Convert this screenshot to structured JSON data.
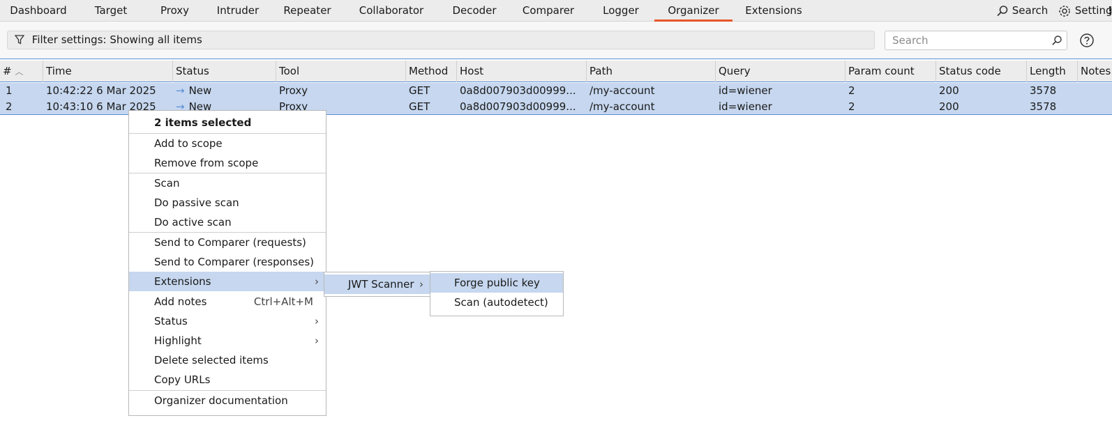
{
  "tabs": [
    {
      "label": "Dashboard"
    },
    {
      "label": "Target"
    },
    {
      "label": "Proxy"
    },
    {
      "label": "Intruder"
    },
    {
      "label": "Repeater"
    },
    {
      "label": "Collaborator"
    },
    {
      "label": "Decoder"
    },
    {
      "label": "Comparer"
    },
    {
      "label": "Logger"
    },
    {
      "label": "Organizer"
    },
    {
      "label": "Extensions"
    }
  ],
  "active_tab": "Organizer",
  "accent_color": "#e8552a",
  "selection_color": "#c6d7ef",
  "top_right": {
    "search_label": "Search",
    "settings_label": "Setting"
  },
  "filter": {
    "text": "Filter settings: Showing all items"
  },
  "search": {
    "placeholder": "Search"
  },
  "table": {
    "columns": [
      "#",
      "Time",
      "Status",
      "Tool",
      "Method",
      "Host",
      "Path",
      "Query",
      "Param count",
      "Status code",
      "Length",
      "Notes"
    ],
    "rows": [
      {
        "num": "1",
        "time": "10:42:22 6 Mar 2025",
        "status": "New",
        "tool": "Proxy",
        "method": "GET",
        "host": "0a8d007903d00999...",
        "path": "/my-account",
        "query": "id=wiener",
        "param_count": "2",
        "status_code": "200",
        "length": "3578",
        "notes": ""
      },
      {
        "num": "2",
        "time": "10:43:10 6 Mar 2025",
        "status": "New",
        "tool": "Proxy",
        "method": "GET",
        "host": "0a8d007903d00999...",
        "path": "/my-account",
        "query": "id=wiener",
        "param_count": "2",
        "status_code": "200",
        "length": "3578",
        "notes": ""
      }
    ]
  },
  "context_menu": {
    "header": "2 items selected",
    "items": [
      {
        "label": "Add to scope"
      },
      {
        "label": "Remove from scope"
      },
      {
        "label": "Scan"
      },
      {
        "label": "Do passive scan"
      },
      {
        "label": "Do active scan"
      },
      {
        "label": "Send to Comparer (requests)"
      },
      {
        "label": "Send to Comparer (responses)"
      },
      {
        "label": "Extensions",
        "submenu": true
      },
      {
        "label": "Add notes",
        "shortcut": "Ctrl+Alt+M"
      },
      {
        "label": "Status",
        "submenu": true
      },
      {
        "label": "Highlight",
        "submenu": true
      },
      {
        "label": "Delete selected items"
      },
      {
        "label": "Copy URLs"
      },
      {
        "label": "Organizer documentation"
      }
    ]
  },
  "extensions_submenu": {
    "items": [
      {
        "label": "JWT Scanner"
      }
    ]
  },
  "jwt_submenu": {
    "items": [
      {
        "label": "Forge public key"
      },
      {
        "label": "Scan (autodetect)"
      }
    ]
  }
}
